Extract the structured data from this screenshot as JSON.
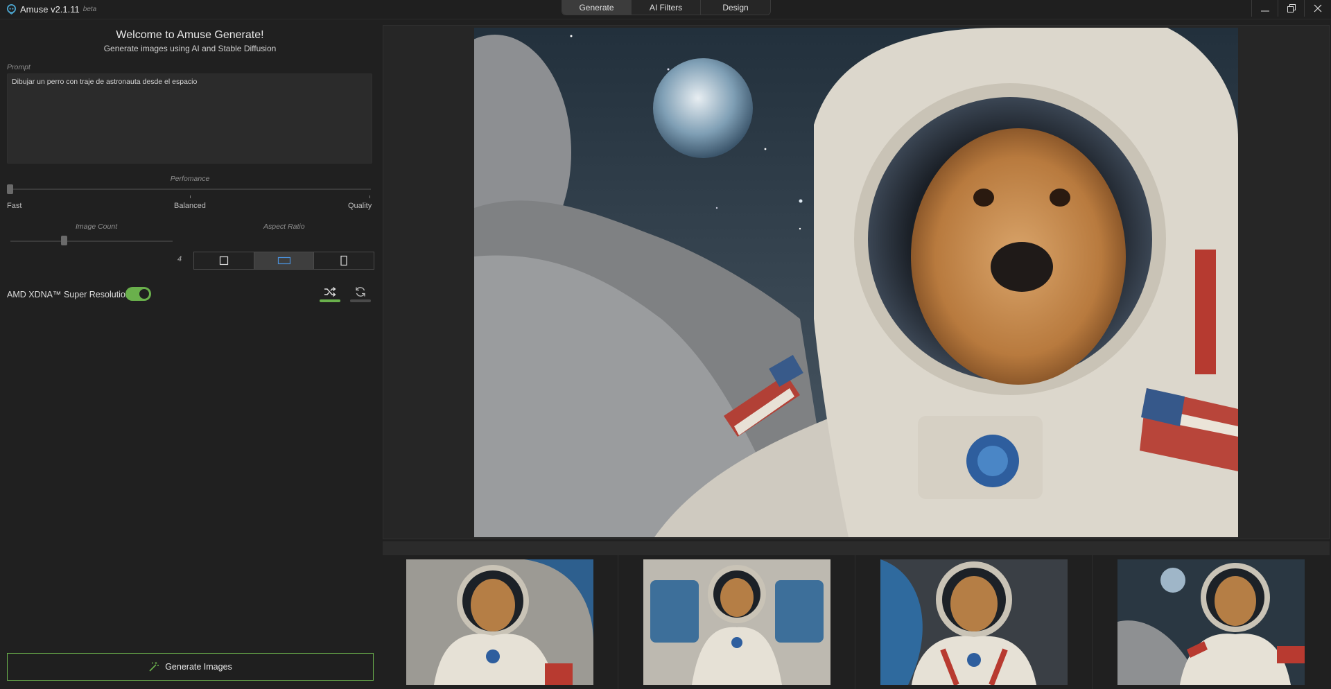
{
  "app": {
    "name": "Amuse v2.1.11",
    "badge": "beta"
  },
  "tabs": [
    {
      "label": "Generate",
      "active": true
    },
    {
      "label": "AI Filters",
      "active": false
    },
    {
      "label": "Design",
      "active": false
    }
  ],
  "window_controls": [
    "minimize-icon",
    "restore-icon",
    "close-icon"
  ],
  "header": {
    "title": "Welcome to Amuse Generate!",
    "subtitle": "Generate images using AI and Stable Diffusion"
  },
  "prompt": {
    "label": "Prompt",
    "value": "Dibujar un perro con traje de astronauta desde el espacio"
  },
  "performance": {
    "label": "Perfomance",
    "options": [
      "Fast",
      "Balanced",
      "Quality"
    ],
    "selected": "Fast"
  },
  "image_count": {
    "label": "Image Count",
    "value": "4"
  },
  "aspect_ratio": {
    "label": "Aspect Ratio",
    "options": [
      "square",
      "landscape",
      "portrait"
    ],
    "selected": "landscape"
  },
  "super_resolution": {
    "label": "AMD XDNA™ Super Resolution",
    "enabled": true
  },
  "modes": [
    {
      "icon": "shuffle-icon",
      "active": true
    },
    {
      "icon": "refresh-icon",
      "active": false
    }
  ],
  "generate_button": {
    "label": "Generate Images",
    "icon": "magic-wand-icon"
  },
  "colors": {
    "accent": "#6ab04c",
    "selected_ratio": "#4a90d9",
    "background": "#202020"
  }
}
